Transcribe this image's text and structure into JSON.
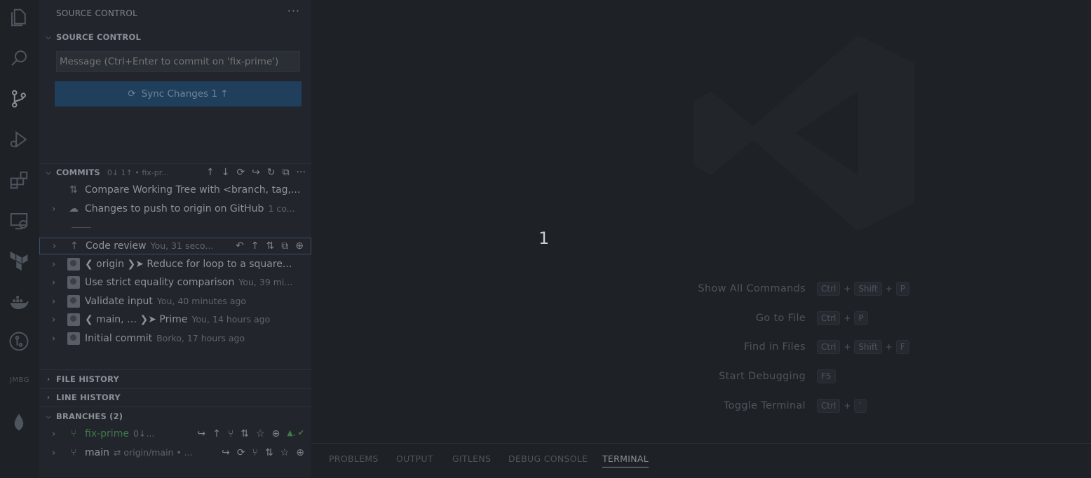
{
  "sidebar": {
    "title": "SOURCE CONTROL",
    "more": "···",
    "scm_section": "SOURCE CONTROL",
    "commit_placeholder": "Message (Ctrl+Enter to commit on 'fix-prime')",
    "sync_label": "Sync Changes 1 ↑",
    "commits_section": "COMMITS",
    "commits_sub": "0↓ 1↑ • fix-pr...",
    "commit_rows": [
      {
        "text": "Compare Working Tree with <branch, tag,...",
        "meta": ""
      },
      {
        "text": "Changes to push to origin on GitHub",
        "meta": "1 co..."
      },
      {
        "text": "Code review",
        "meta": "You, 31 seco..."
      },
      {
        "text": "❮ origin ❯➤  Reduce for loop to a square...",
        "meta": ""
      },
      {
        "text": "Use strict equality comparison",
        "meta": "You, 39 mi..."
      },
      {
        "text": "Validate input",
        "meta": "You, 40 minutes ago"
      },
      {
        "text": "❮ main, … ❯➤  Prime",
        "meta": "You, 14 hours ago"
      },
      {
        "text": "Initial commit",
        "meta": "Borko, 17 hours ago"
      }
    ],
    "file_history": "FILE HISTORY",
    "line_history": "LINE HISTORY",
    "branches_section": "BRANCHES (2)",
    "branches": [
      {
        "name": "fix-prime",
        "meta": "0↓...",
        "status": "▲, ✔"
      },
      {
        "name": "main",
        "meta": "⇄ origin/main • ..."
      }
    ]
  },
  "activity": {
    "text_item": "JMBG"
  },
  "editor": {
    "center_text": "1",
    "shortcuts": [
      {
        "label": "Show All Commands",
        "keys": [
          "Ctrl",
          "Shift",
          "P"
        ]
      },
      {
        "label": "Go to File",
        "keys": [
          "Ctrl",
          "P"
        ]
      },
      {
        "label": "Find in Files",
        "keys": [
          "Ctrl",
          "Shift",
          "F"
        ]
      },
      {
        "label": "Start Debugging",
        "keys": [
          "F5"
        ]
      },
      {
        "label": "Toggle Terminal",
        "keys": [
          "Ctrl",
          "`"
        ]
      }
    ]
  },
  "panel": {
    "tabs": [
      "PROBLEMS",
      "OUTPUT",
      "GITLENS",
      "DEBUG CONSOLE",
      "TERMINAL"
    ]
  }
}
